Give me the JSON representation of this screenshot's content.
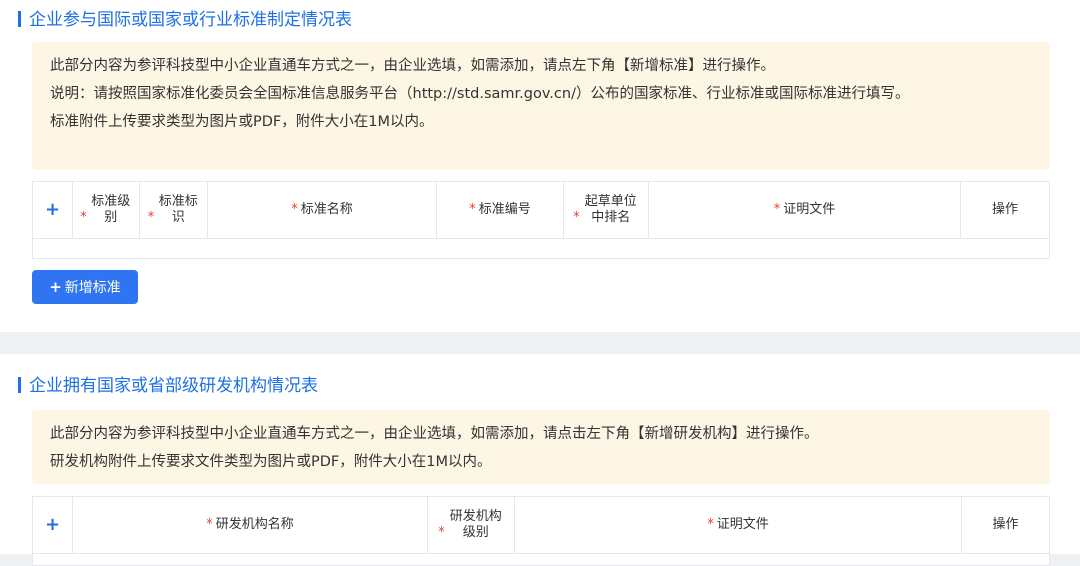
{
  "section1": {
    "title": "企业参与国际或国家或行业标准制定情况表",
    "notice": [
      "此部分内容为参评科技型中小企业直通车方式之一，由企业选填，如需添加，请点左下角【新增标准】进行操作。",
      "说明：请按照国家标准化委员会全国标准信息服务平台（http://std.samr.gov.cn/）公布的国家标准、行业标准或国际标准进行填写。",
      "标准附件上传要求类型为图片或PDF，附件大小在1M以内。"
    ],
    "table": {
      "add_icon": "plus-icon",
      "columns": [
        {
          "label": "标准级别",
          "required": true
        },
        {
          "label": "标准标识",
          "required": true
        },
        {
          "label": "标准名称",
          "required": true
        },
        {
          "label": "标准编号",
          "required": true
        },
        {
          "label": "起草单位中排名",
          "required": true
        },
        {
          "label": "证明文件",
          "required": true
        },
        {
          "label": "操作",
          "required": false
        }
      ],
      "rows": []
    },
    "add_button": "新增标准"
  },
  "section2": {
    "title": "企业拥有国家或省部级研发机构情况表",
    "notice": [
      "此部分内容为参评科技型中小企业直通车方式之一，由企业选填，如需添加，请点击左下角【新增研发机构】进行操作。",
      "研发机构附件上传要求文件类型为图片或PDF，附件大小在1M以内。"
    ],
    "table": {
      "add_icon": "plus-icon",
      "columns": [
        {
          "label": "研发机构名称",
          "required": true
        },
        {
          "label": "研发机构级别",
          "required": true
        },
        {
          "label": "证明文件",
          "required": true
        },
        {
          "label": "操作",
          "required": false
        }
      ]
    }
  },
  "colors": {
    "accent": "#1f6fe5",
    "button": "#2f74f0",
    "notice_bg": "#fdf6e4",
    "required": "#e53935"
  }
}
